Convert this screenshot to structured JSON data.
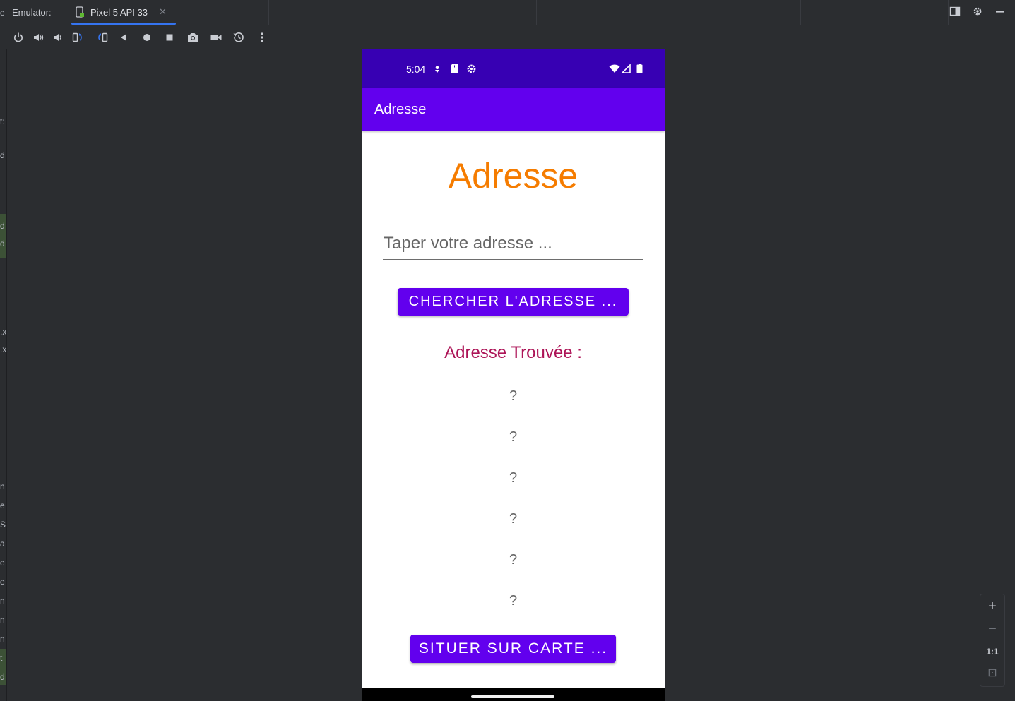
{
  "ide": {
    "emulator_label": "Emulator:",
    "device_tab": {
      "label": "Pixel 5 API 33",
      "close_glyph": "✕"
    },
    "toolbar_icons": [
      "power-icon",
      "volume-up-icon",
      "volume-down-icon",
      "rotate-left-icon",
      "rotate-right-icon",
      "back-icon",
      "home-icon",
      "overview-icon",
      "screenshot-icon",
      "screen-record-icon",
      "snapshot-icon",
      "more-icon"
    ],
    "window_icons": [
      "layout-icon",
      "settings-icon",
      "minimize-icon"
    ],
    "left_strip_chars": [
      "e",
      "t:",
      "d",
      "d",
      "d",
      ".x",
      ".x",
      "n",
      "e",
      "S",
      "a",
      "e",
      "e",
      "n",
      "n",
      "n",
      "t",
      "d"
    ],
    "zoom": {
      "zoom_in": "+",
      "zoom_out": "−",
      "ratio": "1:1",
      "fit": "⊡"
    }
  },
  "device": {
    "status_bar": {
      "time": "5:04"
    },
    "app_bar": {
      "title": "Adresse"
    },
    "content": {
      "title": "Adresse",
      "address_input": {
        "placeholder": "Taper votre adresse ...",
        "value": ""
      },
      "search_button": "CHERCHER L'ADRESSE ...",
      "found_label": "Adresse Trouvée :",
      "results": [
        "?",
        "?",
        "?",
        "?",
        "?",
        "?"
      ],
      "map_button": "SITUER SUR CARTE ..."
    }
  },
  "colors": {
    "status_bar": "#3700b3",
    "app_bar": "#6200ee",
    "title": "#f57c00",
    "found_label": "#ad1457",
    "ide_accent": "#3574f0"
  }
}
